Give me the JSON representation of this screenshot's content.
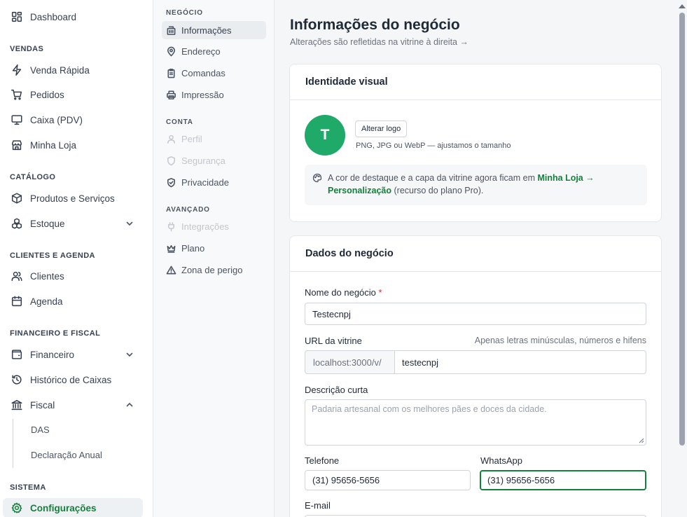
{
  "sidebar": {
    "dashboard": "Dashboard",
    "sections": {
      "vendas": "VENDAS",
      "catalogo": "CATÁLOGO",
      "clientes": "CLIENTES E AGENDA",
      "financeiro": "FINANCEIRO E FISCAL",
      "sistema": "SISTEMA"
    },
    "items": {
      "venda_rapida": "Venda Rápida",
      "pedidos": "Pedidos",
      "caixa": "Caixa (PDV)",
      "minha_loja": "Minha Loja",
      "produtos": "Produtos e Serviços",
      "estoque": "Estoque",
      "clientes": "Clientes",
      "agenda": "Agenda",
      "financeiro": "Financeiro",
      "historico": "Histórico de Caixas",
      "fiscal": "Fiscal",
      "das": "DAS",
      "declaracao": "Declaração Anual",
      "configuracoes": "Configurações"
    }
  },
  "subnav": {
    "negocio_label": "NEGÓCIO",
    "informacoes": "Informações",
    "endereco": "Endereço",
    "comandas": "Comandas",
    "impressao": "Impressão",
    "conta_label": "CONTA",
    "perfil": "Perfil",
    "seguranca": "Segurança",
    "privacidade": "Privacidade",
    "avancado_label": "AVANÇADO",
    "integracoes": "Integrações",
    "plano": "Plano",
    "zona_perigo": "Zona de perigo"
  },
  "main": {
    "title": "Informações do negócio",
    "subtitle": "Alterações são refletidas na vitrine à direita →",
    "identity": {
      "title": "Identidade visual",
      "logo_letter": "T",
      "change_logo": "Alterar logo",
      "logo_hint": "PNG, JPG ou WebP — ajustamos o tamanho",
      "info_text_1": "A cor de destaque e a capa da vitrine agora ficam em ",
      "info_link_1": "Minha Loja →",
      "info_link_2": "Personalização",
      "info_text_2": " (recurso do plano Pro)."
    },
    "business": {
      "title": "Dados do negócio",
      "name_label": "Nome do negócio",
      "name_required": "*",
      "name_value": "Testecnpj",
      "url_label": "URL da vitrine",
      "url_hint": "Apenas letras minúsculas, números e hifens",
      "url_prefix": "localhost:3000/v/",
      "url_value": "testecnpj",
      "desc_label": "Descrição curta",
      "desc_placeholder": "Padaria artesanal com os melhores pães e doces da cidade.",
      "phone_label": "Telefone",
      "phone_value": "(31) 95656-5656",
      "whatsapp_label": "WhatsApp",
      "whatsapp_value": "(31) 95656-5656",
      "email_label": "E-mail"
    }
  },
  "colors": {
    "accent": "#15803d",
    "logo_bg": "#1faa6a",
    "required": "#dc2626"
  }
}
